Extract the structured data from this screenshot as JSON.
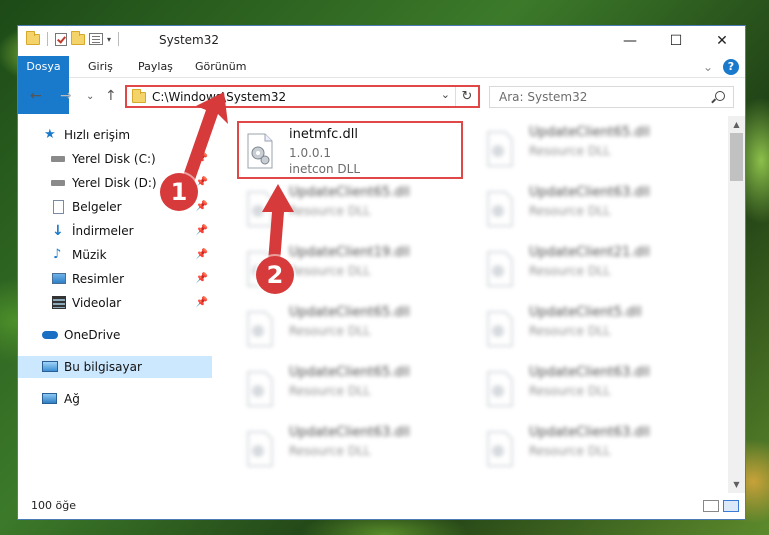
{
  "window": {
    "title": "System32",
    "caption": {
      "minimize": "—",
      "maximize": "☐",
      "close": "✕"
    }
  },
  "ribbon": {
    "tabs": [
      "Dosya",
      "Giriş",
      "Paylaş",
      "Görünüm"
    ],
    "expand_glyph": "⌄",
    "help_glyph": "?"
  },
  "nav_buttons": {
    "back": "←",
    "forward": "→",
    "recent": "⌄",
    "up": "↑"
  },
  "address": {
    "path": "C:\\Windows\\System32",
    "dropdown": "⌄",
    "refresh": "↻"
  },
  "search": {
    "placeholder": "Ara: System32"
  },
  "sidebar": {
    "items": [
      {
        "label": "Hızlı erişim",
        "icon": "star-icon",
        "pinned": false
      },
      {
        "label": "Yerel Disk (C:)",
        "icon": "drive-icon",
        "pinned": true
      },
      {
        "label": "Yerel Disk (D:)",
        "icon": "drive-icon",
        "pinned": true
      },
      {
        "label": "Belgeler",
        "icon": "documents-icon",
        "pinned": true
      },
      {
        "label": "İndirmeler",
        "icon": "download-icon",
        "pinned": true
      },
      {
        "label": "Müzik",
        "icon": "music-icon",
        "pinned": true
      },
      {
        "label": "Resimler",
        "icon": "pictures-icon",
        "pinned": true
      },
      {
        "label": "Videolar",
        "icon": "videos-icon",
        "pinned": true
      },
      {
        "label": "OneDrive",
        "icon": "cloud-icon",
        "pinned": false
      },
      {
        "label": "Bu bilgisayar",
        "icon": "computer-icon",
        "pinned": false,
        "selected": true
      },
      {
        "label": "Ağ",
        "icon": "network-icon",
        "pinned": false
      }
    ]
  },
  "files": [
    {
      "name": "inetmfc.dll",
      "version": "1.0.0.1",
      "description": "inetcon DLL",
      "highlighted": true
    },
    {
      "name": "UpdateClient65.dll",
      "description": "Resource DLL"
    },
    {
      "name": "UpdateClient65.dll",
      "description": "Resource DLL"
    },
    {
      "name": "UpdateClient63.dll",
      "description": "Resource DLL"
    },
    {
      "name": "UpdateClient19.dll",
      "description": "Resource DLL"
    },
    {
      "name": "UpdateClient21.dll",
      "description": "Resource DLL"
    },
    {
      "name": "UpdateClient65.dll",
      "description": "Resource DLL"
    },
    {
      "name": "UpdateClient5.dll",
      "description": "Resource DLL"
    },
    {
      "name": "UpdateClient65.dll",
      "description": "Resource DLL"
    },
    {
      "name": "UpdateClient63.dll",
      "description": "Resource DLL"
    },
    {
      "name": "UpdateClient63.dll",
      "description": "Resource DLL"
    },
    {
      "name": "UpdateClient63.dll",
      "description": "Resource DLL"
    }
  ],
  "status": {
    "item_count": "100 öğe"
  },
  "annotations": {
    "badge1": "1",
    "badge2": "2",
    "color": "#d63a3a"
  }
}
